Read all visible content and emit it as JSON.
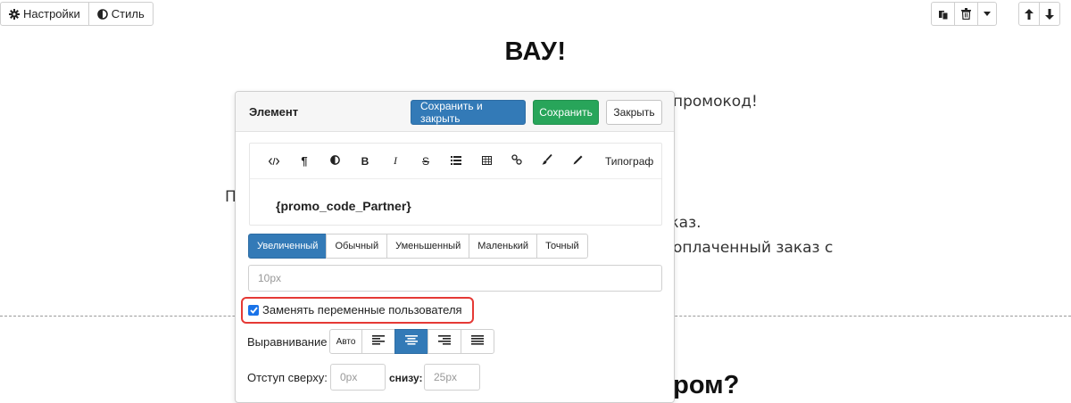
{
  "toolbar": {
    "settings_label": "Настройки",
    "style_label": "Стиль"
  },
  "page": {
    "heading": "ВАУ!",
    "promo_text": "промокод!",
    "left_fragment": "П",
    "order_text": "аказ.",
    "paid_order_text": "оплаченный заказ с",
    "bottom_heading": "ером?"
  },
  "panel": {
    "title": "Элемент",
    "save_close_label": "Сохранить и закрыть",
    "save_label": "Сохранить",
    "close_label": "Закрыть",
    "editor_toolbar": {
      "typograph_label": "Типограф"
    },
    "editor_content": "{promo_code_Partner}",
    "size_options": [
      "Увеличенный",
      "Обычный",
      "Уменьшенный",
      "Маленький",
      "Точный"
    ],
    "size_selected": "Увеличенный",
    "size_input_placeholder": "10px",
    "replace_vars_label": "Заменять переменные пользователя",
    "replace_vars_checked": true,
    "align_label": "Выравнивание",
    "align_auto_label": "Авто",
    "align_selected": "center",
    "margin_top_label": "Отступ сверху:",
    "margin_top_placeholder": "0px",
    "margin_bottom_label": "снизу:",
    "margin_bottom_placeholder": "25px"
  },
  "colors": {
    "primary": "#337ab7",
    "success": "#28a55a",
    "highlight": "#e53935",
    "checkbox": "#1a73e8"
  }
}
